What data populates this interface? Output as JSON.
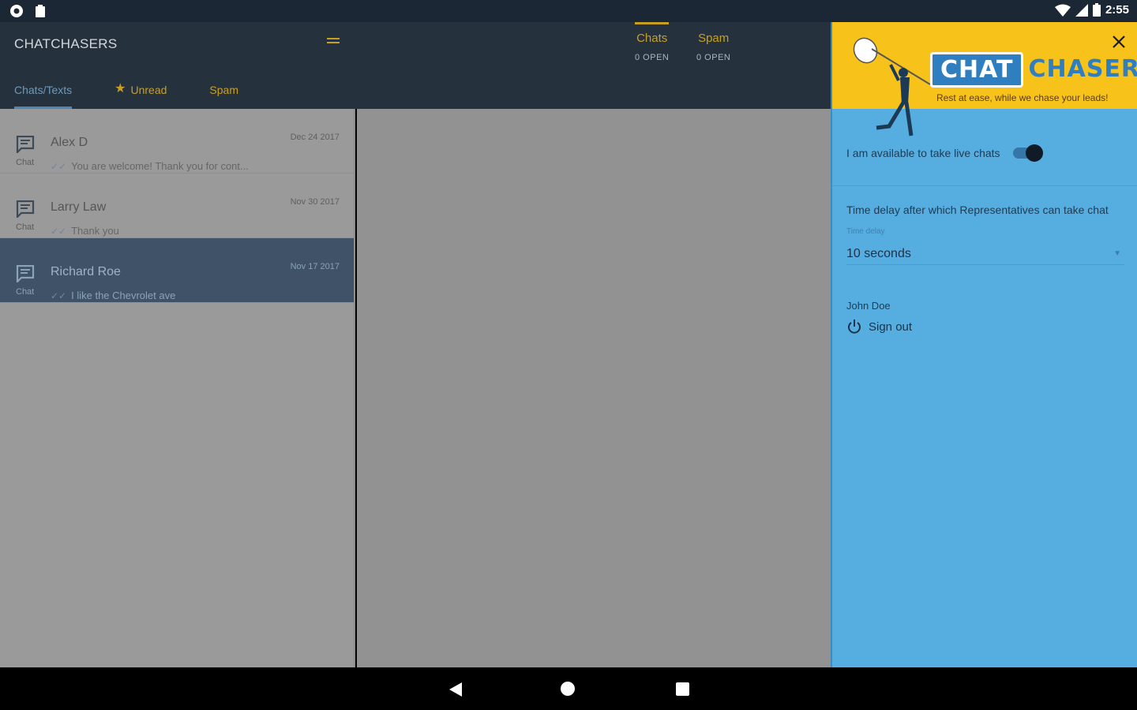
{
  "status_bar": {
    "time": "2:55"
  },
  "toolbar": {
    "brand": "CHATCHASERS",
    "tabs": [
      {
        "label": "Chats/Texts"
      },
      {
        "label": "Unread"
      },
      {
        "label": "Spam"
      }
    ],
    "counters": [
      {
        "label": "Chats",
        "count": "0 OPEN"
      },
      {
        "label": "Spam",
        "count": "0 OPEN"
      }
    ]
  },
  "chats": [
    {
      "name": "Alex D",
      "type": "Chat",
      "date": "Dec 24 2017",
      "message": "You are welcome! Thank you for cont..."
    },
    {
      "name": "Larry Law",
      "type": "Chat",
      "date": "Nov 30 2017",
      "message": "Thank you"
    },
    {
      "name": "Richard Roe",
      "type": "Chat",
      "date": "Nov 17 2017",
      "message": "I like the Chevrolet ave"
    }
  ],
  "drawer": {
    "logo_left": "CHAT",
    "logo_right": "CHASERS",
    "tagline": "Rest at ease, while we chase your leads!",
    "available_label": "I am available to take live chats",
    "available_on": true,
    "delay_title": "Time delay after which Representatives can take chat",
    "delay_label": "Time delay",
    "delay_value": "10 seconds",
    "user_name": "John Doe",
    "signout_label": "Sign out"
  },
  "colors": {
    "toolbar": "#26313e",
    "accent_gold": "#c8a021",
    "drawer_blue": "#56aee0",
    "drawer_header": "#f7c21a",
    "selected_row": "#3f5268"
  }
}
